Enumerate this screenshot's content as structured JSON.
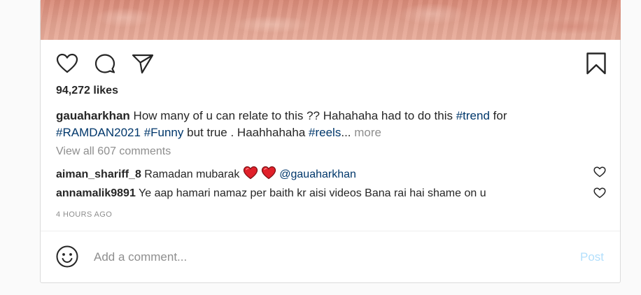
{
  "media": {
    "icon": "photo-media"
  },
  "actions": {
    "like_icon": "heart-outline-icon",
    "comment_icon": "comment-bubble-icon",
    "share_icon": "paper-plane-icon",
    "save_icon": "bookmark-icon"
  },
  "likes": {
    "text": "94,272 likes"
  },
  "caption": {
    "username": "gauaharkhan",
    "text_1": " How many of u can relate to this ?? Hahahaha had to do this ",
    "tag_trend": "#trend",
    "text_2": " for ",
    "tag_ramdan": "#RAMDAN2021",
    "text_3": " ",
    "tag_funny": "#Funny",
    "text_4": " but true . Haahhahaha ",
    "tag_reels": "#reels",
    "ellipsis": "...",
    "more_label": " more"
  },
  "view_all_comments": "View all 607 comments",
  "comments": [
    {
      "username": "aiman_shariff_8",
      "text": " Ramadan mubarak ",
      "mention": " @gauaharkhan"
    },
    {
      "username": "annamalik9891",
      "text": " Ye aap hamari namaz per baith kr aisi videos Bana rai hai shame on u"
    }
  ],
  "timestamp": "4 HOURS AGO",
  "add_comment": {
    "placeholder": "Add a comment...",
    "post_label": "Post"
  },
  "colors": {
    "hashtag": "#00376b",
    "muted": "#8e8e8e",
    "post_disabled": "#b2dffc",
    "heart_red": "#e0202a"
  }
}
